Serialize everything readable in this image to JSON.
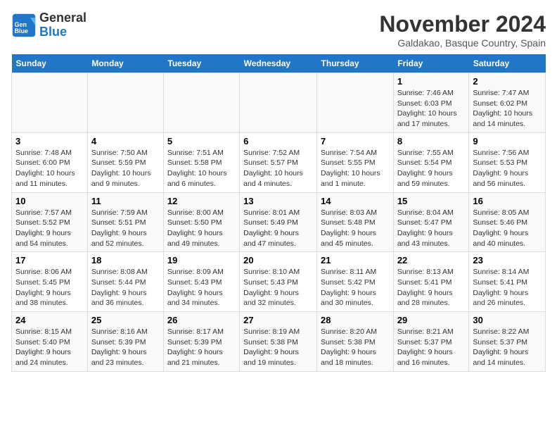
{
  "logo": {
    "general": "General",
    "blue": "Blue"
  },
  "title": "November 2024",
  "location": "Galdakao, Basque Country, Spain",
  "days_header": [
    "Sunday",
    "Monday",
    "Tuesday",
    "Wednesday",
    "Thursday",
    "Friday",
    "Saturday"
  ],
  "weeks": [
    [
      {
        "num": "",
        "info": ""
      },
      {
        "num": "",
        "info": ""
      },
      {
        "num": "",
        "info": ""
      },
      {
        "num": "",
        "info": ""
      },
      {
        "num": "",
        "info": ""
      },
      {
        "num": "1",
        "info": "Sunrise: 7:46 AM\nSunset: 6:03 PM\nDaylight: 10 hours and 17 minutes."
      },
      {
        "num": "2",
        "info": "Sunrise: 7:47 AM\nSunset: 6:02 PM\nDaylight: 10 hours and 14 minutes."
      }
    ],
    [
      {
        "num": "3",
        "info": "Sunrise: 7:48 AM\nSunset: 6:00 PM\nDaylight: 10 hours and 11 minutes."
      },
      {
        "num": "4",
        "info": "Sunrise: 7:50 AM\nSunset: 5:59 PM\nDaylight: 10 hours and 9 minutes."
      },
      {
        "num": "5",
        "info": "Sunrise: 7:51 AM\nSunset: 5:58 PM\nDaylight: 10 hours and 6 minutes."
      },
      {
        "num": "6",
        "info": "Sunrise: 7:52 AM\nSunset: 5:57 PM\nDaylight: 10 hours and 4 minutes."
      },
      {
        "num": "7",
        "info": "Sunrise: 7:54 AM\nSunset: 5:55 PM\nDaylight: 10 hours and 1 minute."
      },
      {
        "num": "8",
        "info": "Sunrise: 7:55 AM\nSunset: 5:54 PM\nDaylight: 9 hours and 59 minutes."
      },
      {
        "num": "9",
        "info": "Sunrise: 7:56 AM\nSunset: 5:53 PM\nDaylight: 9 hours and 56 minutes."
      }
    ],
    [
      {
        "num": "10",
        "info": "Sunrise: 7:57 AM\nSunset: 5:52 PM\nDaylight: 9 hours and 54 minutes."
      },
      {
        "num": "11",
        "info": "Sunrise: 7:59 AM\nSunset: 5:51 PM\nDaylight: 9 hours and 52 minutes."
      },
      {
        "num": "12",
        "info": "Sunrise: 8:00 AM\nSunset: 5:50 PM\nDaylight: 9 hours and 49 minutes."
      },
      {
        "num": "13",
        "info": "Sunrise: 8:01 AM\nSunset: 5:49 PM\nDaylight: 9 hours and 47 minutes."
      },
      {
        "num": "14",
        "info": "Sunrise: 8:03 AM\nSunset: 5:48 PM\nDaylight: 9 hours and 45 minutes."
      },
      {
        "num": "15",
        "info": "Sunrise: 8:04 AM\nSunset: 5:47 PM\nDaylight: 9 hours and 43 minutes."
      },
      {
        "num": "16",
        "info": "Sunrise: 8:05 AM\nSunset: 5:46 PM\nDaylight: 9 hours and 40 minutes."
      }
    ],
    [
      {
        "num": "17",
        "info": "Sunrise: 8:06 AM\nSunset: 5:45 PM\nDaylight: 9 hours and 38 minutes."
      },
      {
        "num": "18",
        "info": "Sunrise: 8:08 AM\nSunset: 5:44 PM\nDaylight: 9 hours and 36 minutes."
      },
      {
        "num": "19",
        "info": "Sunrise: 8:09 AM\nSunset: 5:43 PM\nDaylight: 9 hours and 34 minutes."
      },
      {
        "num": "20",
        "info": "Sunrise: 8:10 AM\nSunset: 5:43 PM\nDaylight: 9 hours and 32 minutes."
      },
      {
        "num": "21",
        "info": "Sunrise: 8:11 AM\nSunset: 5:42 PM\nDaylight: 9 hours and 30 minutes."
      },
      {
        "num": "22",
        "info": "Sunrise: 8:13 AM\nSunset: 5:41 PM\nDaylight: 9 hours and 28 minutes."
      },
      {
        "num": "23",
        "info": "Sunrise: 8:14 AM\nSunset: 5:41 PM\nDaylight: 9 hours and 26 minutes."
      }
    ],
    [
      {
        "num": "24",
        "info": "Sunrise: 8:15 AM\nSunset: 5:40 PM\nDaylight: 9 hours and 24 minutes."
      },
      {
        "num": "25",
        "info": "Sunrise: 8:16 AM\nSunset: 5:39 PM\nDaylight: 9 hours and 23 minutes."
      },
      {
        "num": "26",
        "info": "Sunrise: 8:17 AM\nSunset: 5:39 PM\nDaylight: 9 hours and 21 minutes."
      },
      {
        "num": "27",
        "info": "Sunrise: 8:19 AM\nSunset: 5:38 PM\nDaylight: 9 hours and 19 minutes."
      },
      {
        "num": "28",
        "info": "Sunrise: 8:20 AM\nSunset: 5:38 PM\nDaylight: 9 hours and 18 minutes."
      },
      {
        "num": "29",
        "info": "Sunrise: 8:21 AM\nSunset: 5:37 PM\nDaylight: 9 hours and 16 minutes."
      },
      {
        "num": "30",
        "info": "Sunrise: 8:22 AM\nSunset: 5:37 PM\nDaylight: 9 hours and 14 minutes."
      }
    ]
  ]
}
